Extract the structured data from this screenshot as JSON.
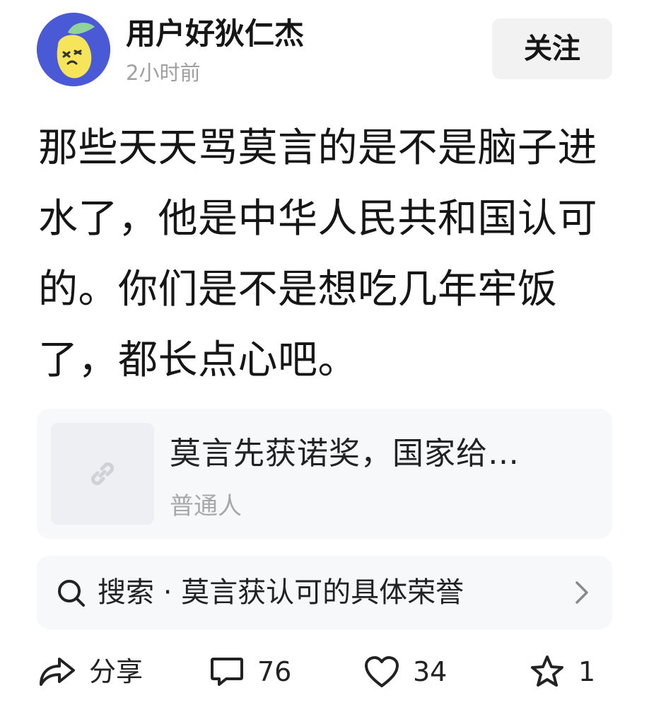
{
  "post": {
    "author": {
      "name": "用户好狄仁杰",
      "avatar_icon": "lemon-avatar-icon"
    },
    "timestamp": "2小时前",
    "follow_label": "关注",
    "text": "那些天天骂莫言的是不是脑子进水了，他是中华人民共和国认可的。你们是不是想吃几年牢饭了，都长点心吧。"
  },
  "link_card": {
    "thumbnail_icon": "link-icon",
    "title": "莫言先获诺奖，国家给…",
    "source": "普通人"
  },
  "search": {
    "icon": "search-icon",
    "label": "搜索 · 莫言获认可的具体荣誉",
    "chevron_icon": "chevron-right-icon"
  },
  "actions": {
    "share": {
      "icon": "share-icon",
      "label": "分享"
    },
    "comment": {
      "icon": "comment-icon",
      "count": "76"
    },
    "like": {
      "icon": "heart-icon",
      "count": "34"
    },
    "favorite": {
      "icon": "star-icon",
      "count": "1"
    }
  },
  "colors": {
    "avatar_bg": "#4a5ad6",
    "avatar_fruit": "#f6e55a",
    "avatar_leaf": "#8fd39a",
    "text_primary": "#161616",
    "text_secondary": "#a0a0a0",
    "card_bg": "#f7f8fa",
    "button_bg": "#f2f2f2"
  }
}
